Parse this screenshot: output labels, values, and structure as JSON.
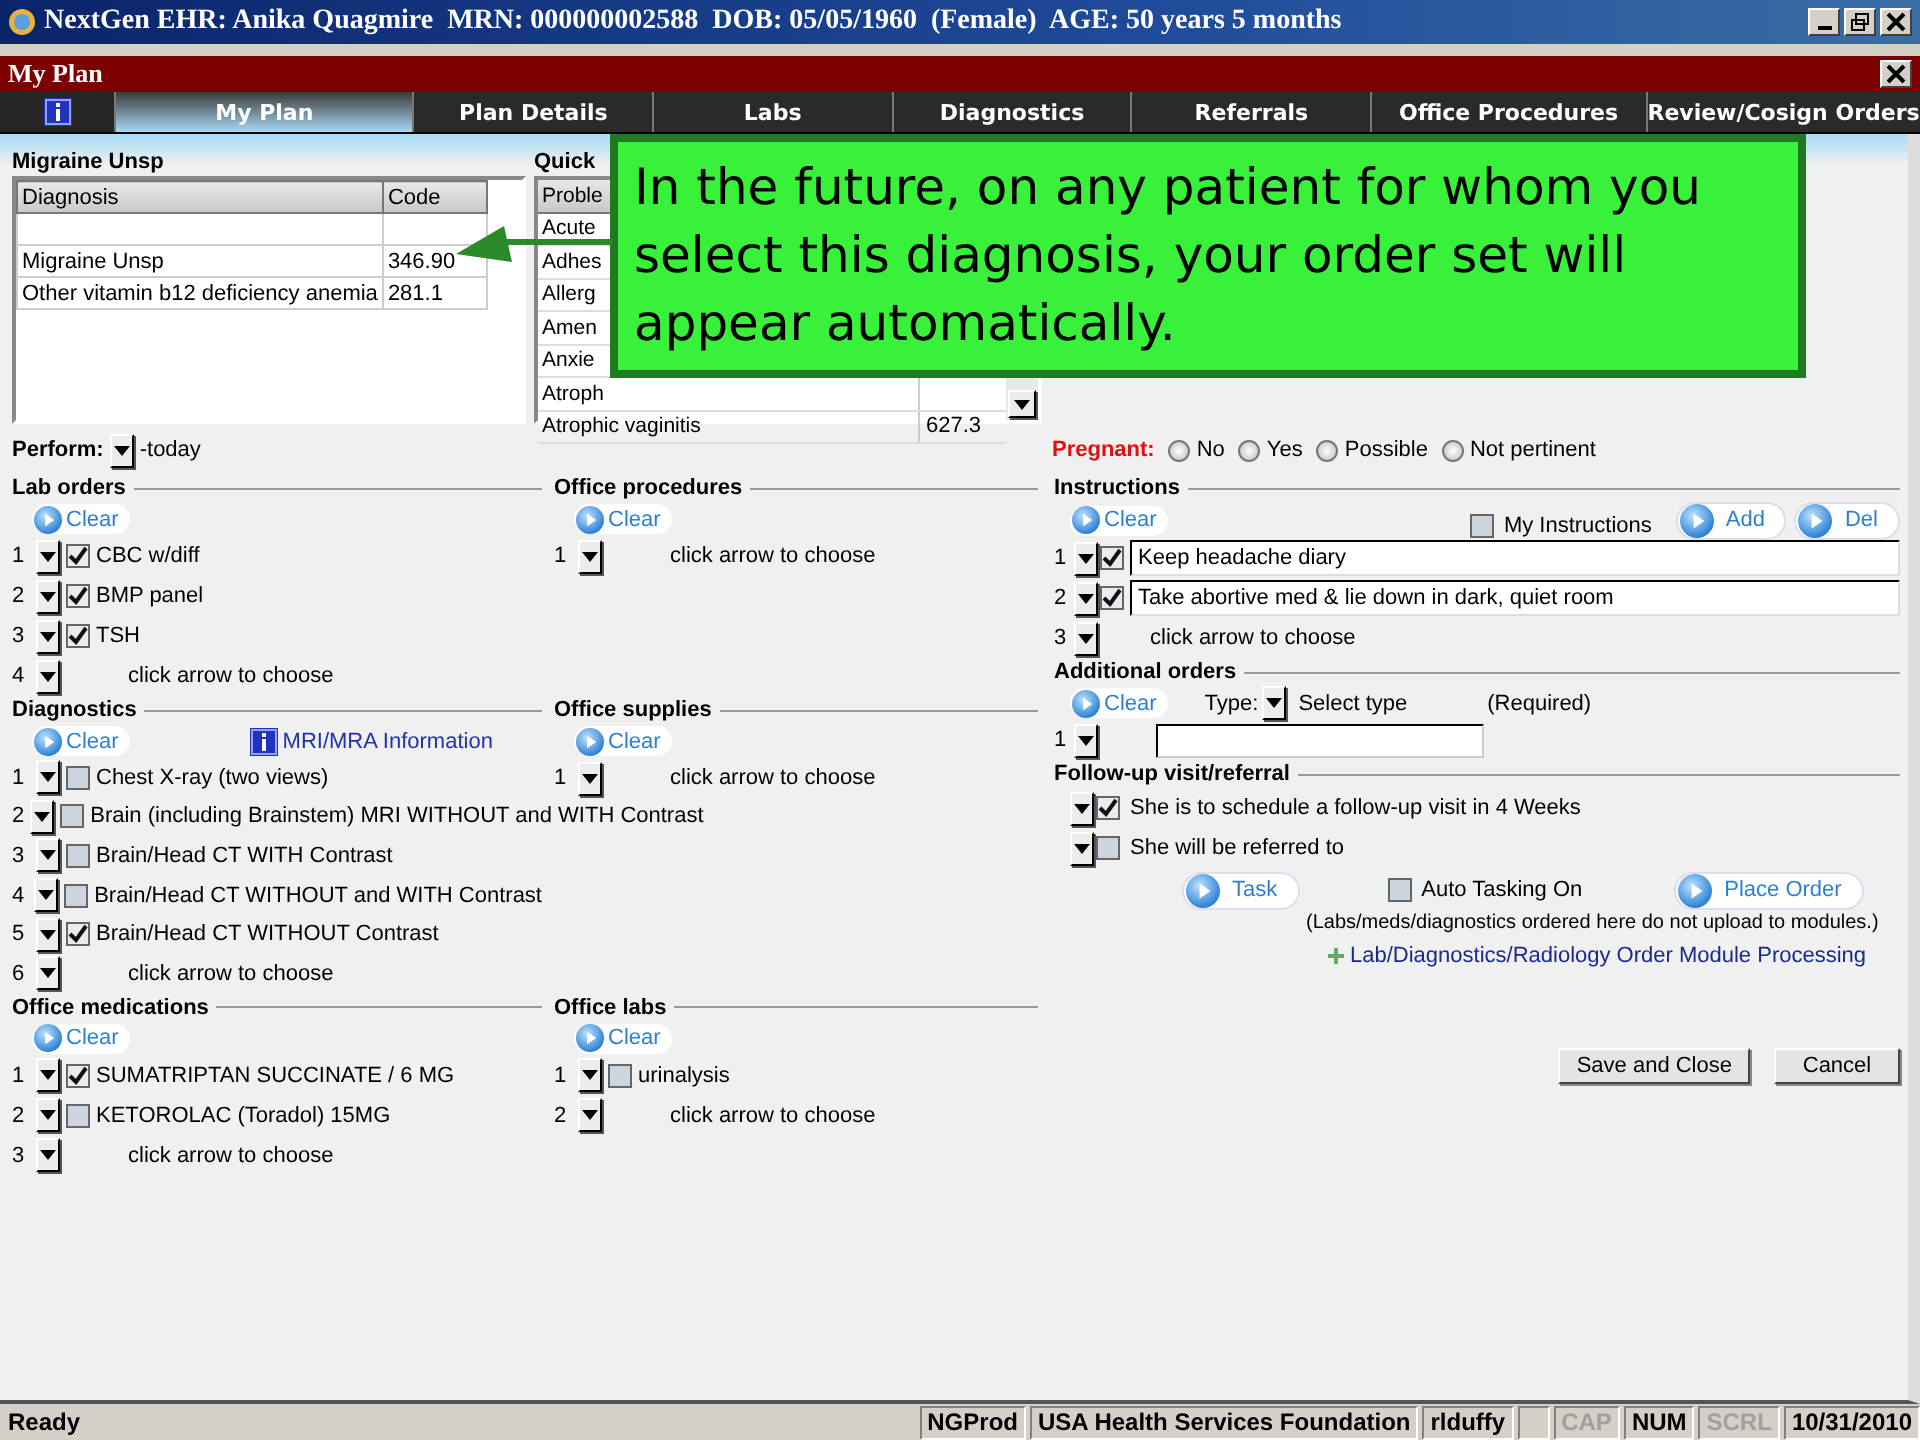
{
  "window": {
    "title": "NextGen EHR: Anika Quagmire  MRN: 000000002588  DOB: 05/05/1960  (Female)  AGE: 50 years 5 months"
  },
  "dialog": {
    "title": "My Plan"
  },
  "tabs": [
    {
      "label": "My Plan",
      "selected": true
    },
    {
      "label": "Plan Details",
      "selected": false
    },
    {
      "label": "Labs",
      "selected": false
    },
    {
      "label": "Diagnostics",
      "selected": false
    },
    {
      "label": "Referrals",
      "selected": false
    },
    {
      "label": "Office Procedures",
      "selected": false
    },
    {
      "label": "Review/Cosign Orders",
      "selected": false
    }
  ],
  "diagnosis_panel": {
    "title": "Migraine Unsp",
    "columns": [
      "Diagnosis",
      "Code"
    ],
    "rows": [
      {
        "diagnosis": "Migraine Unsp",
        "code": "346.90"
      },
      {
        "diagnosis": "Other vitamin b12 deficiency anemia",
        "code": "281.1"
      }
    ]
  },
  "quick_assessments": {
    "title": "Quick",
    "columns": [
      "Proble"
    ],
    "rows": [
      {
        "name": "Acute"
      },
      {
        "name": "Adhes"
      },
      {
        "name": "Allerg"
      },
      {
        "name": "Amen"
      },
      {
        "name": "Anxie"
      },
      {
        "name": "Atroph"
      },
      {
        "name": "Atrophic vaginitis",
        "code": "627.3"
      }
    ]
  },
  "perform": {
    "label": "Perform:",
    "value": "-today"
  },
  "pregnant": {
    "label": "Pregnant:",
    "options": [
      {
        "label": "No",
        "selected": false
      },
      {
        "label": "Yes",
        "selected": false
      },
      {
        "label": "Possible",
        "selected": false
      },
      {
        "label": "Not pertinent",
        "selected": false
      }
    ]
  },
  "lab_orders": {
    "title": "Lab orders",
    "clear": "Clear",
    "items": [
      {
        "number": "1",
        "kind": "check",
        "checked": true,
        "label": "CBC w/diff"
      },
      {
        "number": "2",
        "kind": "check",
        "checked": true,
        "label": "BMP panel"
      },
      {
        "number": "3",
        "kind": "check",
        "checked": true,
        "label": "TSH"
      },
      {
        "number": "4",
        "kind": "empty",
        "label": "click arrow to choose"
      }
    ]
  },
  "office_procedures": {
    "title": "Office procedures",
    "clear": "Clear",
    "items": [
      {
        "number": "1",
        "kind": "empty",
        "label": "click arrow to choose"
      }
    ]
  },
  "diagnostics": {
    "title": "Diagnostics",
    "clear": "Clear",
    "info_link": "MRI/MRA Information",
    "items": [
      {
        "number": "1",
        "kind": "check",
        "checked": false,
        "label": "Chest X-ray (two views)"
      },
      {
        "number": "2",
        "kind": "check",
        "checked": false,
        "label": "Brain (including Brainstem) MRI WITHOUT and WITH Contrast"
      },
      {
        "number": "3",
        "kind": "check",
        "checked": false,
        "label": "Brain/Head CT WITH Contrast"
      },
      {
        "number": "4",
        "kind": "check",
        "checked": false,
        "label": "Brain/Head CT WITHOUT and WITH Contrast"
      },
      {
        "number": "5",
        "kind": "check",
        "checked": true,
        "label": "Brain/Head CT WITHOUT Contrast"
      },
      {
        "number": "6",
        "kind": "empty",
        "label": "click arrow to choose"
      }
    ]
  },
  "office_supplies": {
    "title": "Office supplies",
    "clear": "Clear",
    "items": [
      {
        "number": "1",
        "kind": "empty",
        "label": "click arrow to choose"
      }
    ]
  },
  "office_medications": {
    "title": "Office medications",
    "clear": "Clear",
    "items": [
      {
        "number": "1",
        "kind": "check",
        "checked": true,
        "label": "SUMATRIPTAN SUCCINATE / 6 MG"
      },
      {
        "number": "2",
        "kind": "check",
        "checked": false,
        "label": "KETOROLAC (Toradol) 15MG"
      },
      {
        "number": "3",
        "kind": "empty",
        "label": "click arrow to choose"
      }
    ]
  },
  "office_labs": {
    "title": "Office labs",
    "clear": "Clear",
    "items": [
      {
        "number": "1",
        "kind": "check",
        "checked": false,
        "label": "urinalysis"
      },
      {
        "number": "2",
        "kind": "empty",
        "label": "click arrow to choose"
      }
    ]
  },
  "instructions": {
    "title": "Instructions",
    "clear": "Clear",
    "my_instructions": {
      "label": "My Instructions",
      "checked": false
    },
    "buttons": [
      "Add",
      "Del"
    ],
    "items": [
      {
        "number": "1",
        "kind": "text",
        "checked": true,
        "value": "Keep headache diary"
      },
      {
        "number": "2",
        "kind": "text",
        "checked": true,
        "value": "Take abortive med & lie down in dark, quiet room"
      },
      {
        "number": "3",
        "kind": "empty",
        "label": "click arrow to choose"
      }
    ]
  },
  "additional_orders": {
    "title": "Additional orders",
    "clear": "Clear",
    "type_label": "Type:",
    "type_value": "Select type",
    "required": "(Required)",
    "items": [
      {
        "number": "1"
      }
    ]
  },
  "follow_up": {
    "title": "Follow-up visit/referral",
    "items": [
      {
        "checked": true,
        "label": "She is to schedule a follow-up visit in 4 Weeks"
      },
      {
        "checked": false,
        "label": "She will be referred to"
      }
    ]
  },
  "actions": {
    "task": "Task",
    "auto_tasking": {
      "label": "Auto Tasking On",
      "checked": false
    },
    "place_order": "Place Order",
    "note": "(Labs/meds/diagnostics ordered here do not upload to modules.)",
    "link": "Lab/Diagnostics/Radiology Order Module Processing"
  },
  "buttons": [
    "Save and Close",
    "Cancel"
  ],
  "status_bar": {
    "status": "Ready",
    "panes": [
      {
        "text": "NGProd",
        "disabled": false
      },
      {
        "text": "USA Health Services Foundation",
        "disabled": false
      },
      {
        "text": "rlduffy",
        "disabled": false
      },
      {
        "text": "CAP",
        "disabled": true
      },
      {
        "text": "NUM",
        "disabled": false
      },
      {
        "text": "SCRL",
        "disabled": true
      },
      {
        "text": "10/31/2010",
        "disabled": false
      }
    ]
  },
  "callout": {
    "text": "In the future, on any patient for whom you select this diagnosis, your order set will appear automatically."
  }
}
